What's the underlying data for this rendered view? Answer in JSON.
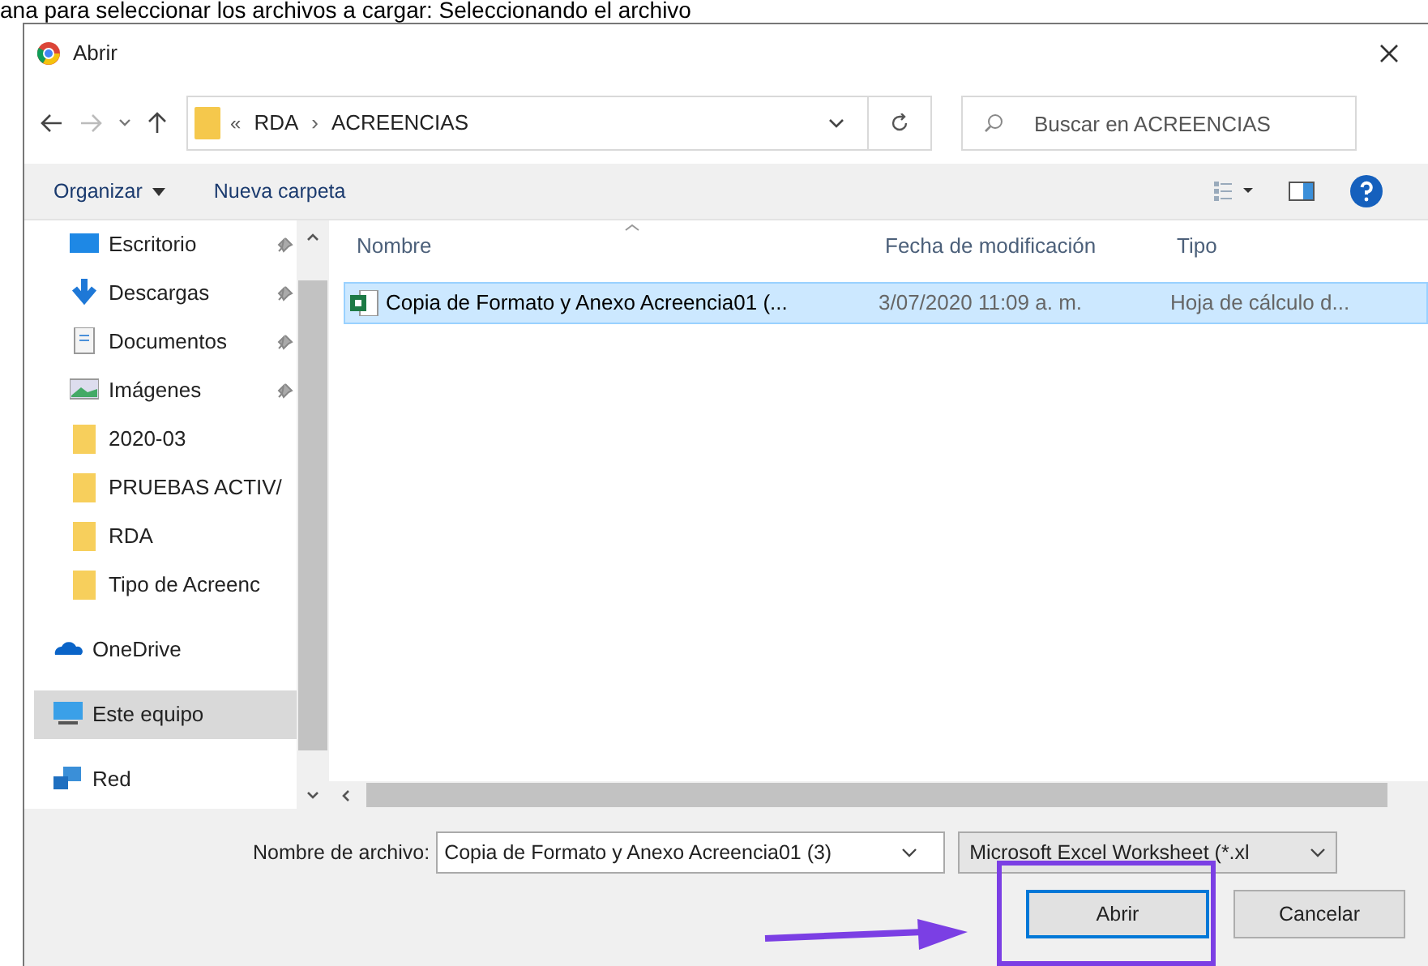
{
  "caption": "ana para seleccionar los archivos a cargar: Seleccionando el archivo",
  "window": {
    "title": "Abrir"
  },
  "address": {
    "overflow": "«",
    "crumbs": [
      "RDA",
      "ACREENCIAS"
    ],
    "separator": "›"
  },
  "search": {
    "placeholder": "Buscar en ACREENCIAS"
  },
  "toolbar": {
    "organize": "Organizar",
    "new_folder": "Nueva carpeta"
  },
  "nav": [
    {
      "label": "Escritorio",
      "kind": "desktop",
      "pinned": true,
      "selected": false
    },
    {
      "label": "Descargas",
      "kind": "download",
      "pinned": true,
      "selected": false
    },
    {
      "label": "Documentos",
      "kind": "documents",
      "pinned": true,
      "selected": false
    },
    {
      "label": "Imágenes",
      "kind": "pictures",
      "pinned": true,
      "selected": false
    },
    {
      "label": "2020-03",
      "kind": "folder",
      "pinned": false,
      "selected": false
    },
    {
      "label": "PRUEBAS ACTIV/",
      "kind": "folder",
      "pinned": false,
      "selected": false
    },
    {
      "label": "RDA",
      "kind": "folder",
      "pinned": false,
      "selected": false
    },
    {
      "label": "Tipo de Acreenc",
      "kind": "folder",
      "pinned": false,
      "selected": false
    },
    {
      "label": "OneDrive",
      "kind": "cloud",
      "pinned": false,
      "selected": false
    },
    {
      "label": "Este equipo",
      "kind": "computer",
      "pinned": false,
      "selected": true
    },
    {
      "label": "Red",
      "kind": "network",
      "pinned": false,
      "selected": false
    }
  ],
  "table": {
    "columns": [
      "Nombre",
      "Fecha de modificación",
      "Tipo"
    ],
    "rows": [
      {
        "cells": [
          "Copia de Formato y Anexo Acreencia01 (...",
          "3/07/2020 11:09 a. m.",
          "Hoja de cálculo d..."
        ],
        "selected": true
      }
    ]
  },
  "footer": {
    "file_name_label": "Nombre de archivo:",
    "file_name": "Copia de Formato y Anexo Acreencia01 (3)",
    "file_type": "Microsoft Excel Worksheet (*.xl",
    "open": "Abrir",
    "cancel": "Cancelar"
  }
}
